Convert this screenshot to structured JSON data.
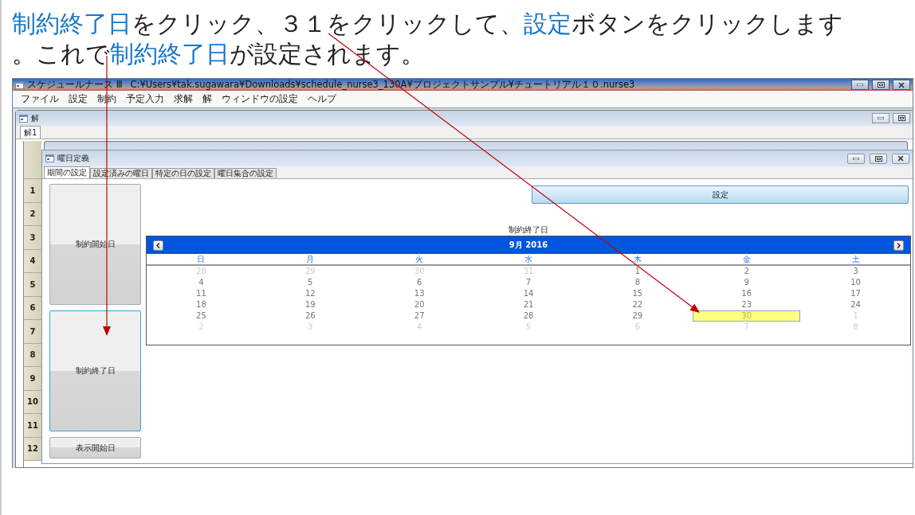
{
  "caption": {
    "lines": [
      [
        {
          "text": "制約終了日",
          "highlight": true
        },
        {
          "text": "をクリック、３１をクリックして、",
          "highlight": false
        },
        {
          "text": "設定",
          "highlight": true
        },
        {
          "text": "ボタンをクリックします",
          "highlight": false
        }
      ],
      [
        {
          "text": "。これで",
          "highlight": false
        },
        {
          "text": "制約終了日",
          "highlight": true
        },
        {
          "text": "が設定されます。",
          "highlight": false
        }
      ]
    ]
  },
  "app": {
    "title": "スケジュールナース Ⅲ",
    "path": "C:¥Users¥tak.sugawara¥Downloads¥schedule_nurse3_130A¥プロジェクトサンプル¥チュートリアル１０.nurse3",
    "menu": [
      "ファイル",
      "設定",
      "制約",
      "予定入力",
      "求解",
      "解",
      "ウィンドウの設定",
      "ヘルプ"
    ]
  },
  "solution_window": {
    "title": "解",
    "tabs": [
      {
        "label": "解1",
        "selected": true
      }
    ],
    "row_numbers": [
      "1",
      "2",
      "3",
      "4",
      "5",
      "6",
      "7",
      "8",
      "9",
      "10",
      "11",
      "12"
    ]
  },
  "day_definition_window": {
    "title": "曜日定義",
    "tabs": [
      {
        "label": "期間の設定",
        "selected": true
      },
      {
        "label": "設定済みの曜日",
        "selected": false
      },
      {
        "label": "特定の日の設定",
        "selected": false
      },
      {
        "label": "曜日集合の設定",
        "selected": false
      }
    ],
    "date_buttons": [
      {
        "label": "制約開始日",
        "selected": false
      },
      {
        "label": "制約終了日",
        "selected": true
      },
      {
        "label": "表示開始日",
        "selected": false
      }
    ],
    "set_button": "設定",
    "field_label": "制約終了日",
    "calendar": {
      "month": "9月 2016",
      "weekdays": [
        "日",
        "月",
        "火",
        "水",
        "木",
        "金",
        "土"
      ],
      "weeks": [
        [
          {
            "day": "28",
            "muted": true,
            "selected": false
          },
          {
            "day": "29",
            "muted": true,
            "selected": false
          },
          {
            "day": "30",
            "muted": true,
            "selected": false
          },
          {
            "day": "31",
            "muted": true,
            "selected": false
          },
          {
            "day": "1",
            "muted": false,
            "selected": false
          },
          {
            "day": "2",
            "muted": false,
            "selected": false
          },
          {
            "day": "3",
            "muted": false,
            "selected": false
          }
        ],
        [
          {
            "day": "4",
            "muted": false,
            "selected": false
          },
          {
            "day": "5",
            "muted": false,
            "selected": false
          },
          {
            "day": "6",
            "muted": false,
            "selected": false
          },
          {
            "day": "7",
            "muted": false,
            "selected": false
          },
          {
            "day": "8",
            "muted": false,
            "selected": false
          },
          {
            "day": "9",
            "muted": false,
            "selected": false
          },
          {
            "day": "10",
            "muted": false,
            "selected": false
          }
        ],
        [
          {
            "day": "11",
            "muted": false,
            "selected": false
          },
          {
            "day": "12",
            "muted": false,
            "selected": false
          },
          {
            "day": "13",
            "muted": false,
            "selected": false
          },
          {
            "day": "14",
            "muted": false,
            "selected": false
          },
          {
            "day": "15",
            "muted": false,
            "selected": false
          },
          {
            "day": "16",
            "muted": false,
            "selected": false
          },
          {
            "day": "17",
            "muted": false,
            "selected": false
          }
        ],
        [
          {
            "day": "18",
            "muted": false,
            "selected": false
          },
          {
            "day": "19",
            "muted": false,
            "selected": false
          },
          {
            "day": "20",
            "muted": false,
            "selected": false
          },
          {
            "day": "21",
            "muted": false,
            "selected": false
          },
          {
            "day": "22",
            "muted": false,
            "selected": false
          },
          {
            "day": "23",
            "muted": false,
            "selected": false
          },
          {
            "day": "24",
            "muted": false,
            "selected": false
          }
        ],
        [
          {
            "day": "25",
            "muted": false,
            "selected": false
          },
          {
            "day": "26",
            "muted": false,
            "selected": false
          },
          {
            "day": "27",
            "muted": false,
            "selected": false
          },
          {
            "day": "28",
            "muted": false,
            "selected": false
          },
          {
            "day": "29",
            "muted": false,
            "selected": false
          },
          {
            "day": "30",
            "muted": false,
            "selected": true
          },
          {
            "day": "1",
            "muted": true,
            "selected": false
          }
        ],
        [
          {
            "day": "2",
            "muted": true,
            "selected": false
          },
          {
            "day": "3",
            "muted": true,
            "selected": false
          },
          {
            "day": "4",
            "muted": true,
            "selected": false
          },
          {
            "day": "5",
            "muted": true,
            "selected": false
          },
          {
            "day": "6",
            "muted": true,
            "selected": false
          },
          {
            "day": "7",
            "muted": true,
            "selected": false
          },
          {
            "day": "8",
            "muted": true,
            "selected": false
          }
        ]
      ]
    }
  }
}
